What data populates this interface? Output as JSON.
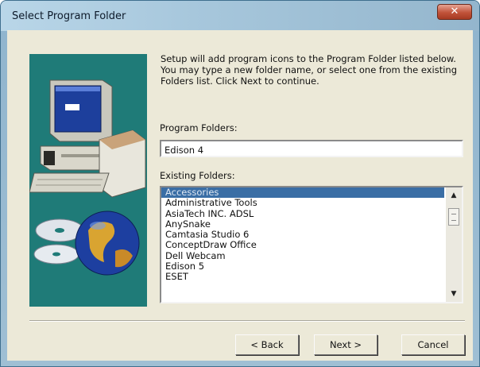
{
  "window": {
    "title": "Select Program Folder"
  },
  "description": "Setup will add program icons to the Program Folder listed below. You may type a new folder name, or select one from the existing Folders list. Click Next to continue.",
  "program_folder": {
    "label": "Program Folders:",
    "value": "Edison 4"
  },
  "existing_folders": {
    "label": "Existing Folders:",
    "items": [
      {
        "label": "Accessories",
        "selected": true
      },
      {
        "label": "Administrative Tools"
      },
      {
        "label": "AsiaTech INC. ADSL"
      },
      {
        "label": "AnySnake"
      },
      {
        "label": "Camtasia Studio 6"
      },
      {
        "label": "ConceptDraw Office"
      },
      {
        "label": "Dell Webcam"
      },
      {
        "label": "Edison 5"
      },
      {
        "label": "ESET"
      }
    ]
  },
  "buttons": {
    "back": "< Back",
    "next": "Next >",
    "cancel": "Cancel"
  },
  "icons": {
    "close": "close-icon",
    "scroll_up": "scroll-up-arrow-icon",
    "scroll_down": "scroll-down-arrow-icon"
  },
  "colors": {
    "art_bg": "#1f7b78",
    "selection": "#3a6ea5",
    "dialog_bg": "#ece9d8"
  }
}
